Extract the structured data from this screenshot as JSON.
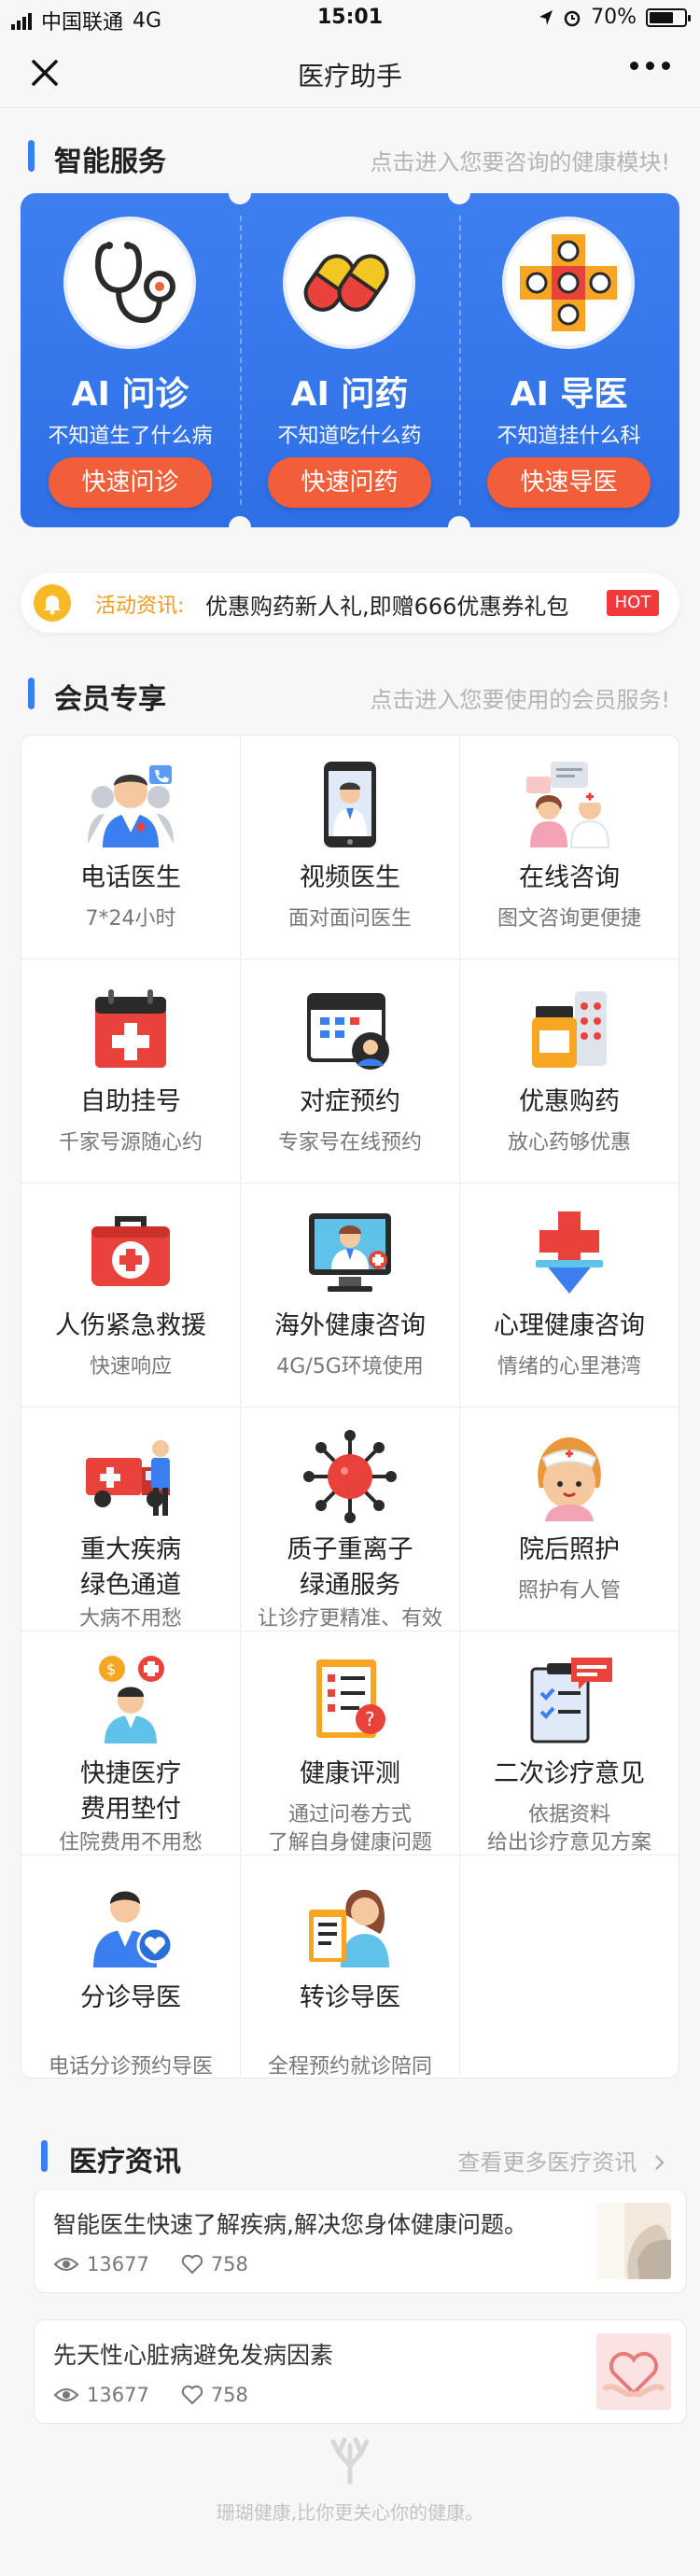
{
  "status_bar": {
    "carrier": "中国联通",
    "network": "4G",
    "time": "15:01",
    "battery": "70%",
    "battery_level": 0.7
  },
  "nav": {
    "title": "医疗助手"
  },
  "smart_service": {
    "title": "智能服务",
    "hint": "点击进入您要咨询的健康模块!",
    "cards": [
      {
        "name": "AI 问诊",
        "sub": "不知道生了什么病",
        "button": "快速问诊"
      },
      {
        "name": "AI 问药",
        "sub": "不知道吃什么药",
        "button": "快速问药"
      },
      {
        "name": "AI 导医",
        "sub": "不知道挂什么科",
        "button": "快速导医"
      }
    ]
  },
  "promo": {
    "label": "活动资讯:",
    "text": "优惠购药新人礼,即赠666优惠券礼包",
    "badge": "HOT"
  },
  "member": {
    "title": "会员专享",
    "hint": "点击进入您要使用的会员服务!",
    "items": [
      {
        "lines": [
          "电话医生"
        ],
        "subs": [
          "7*24小时"
        ]
      },
      {
        "lines": [
          "视频医生"
        ],
        "subs": [
          "面对面问医生"
        ]
      },
      {
        "lines": [
          "在线咨询"
        ],
        "subs": [
          "图文咨询更便捷"
        ]
      },
      {
        "lines": [
          "自助挂号"
        ],
        "subs": [
          "千家号源随心约"
        ]
      },
      {
        "lines": [
          "对症预约"
        ],
        "subs": [
          "专家号在线预约"
        ]
      },
      {
        "lines": [
          "优惠购药"
        ],
        "subs": [
          "放心药够优惠"
        ]
      },
      {
        "lines": [
          "人伤紧急救援"
        ],
        "subs": [
          "快速响应"
        ]
      },
      {
        "lines": [
          "海外健康咨询"
        ],
        "subs": [
          "4G/5G环境使用"
        ]
      },
      {
        "lines": [
          "心理健康咨询"
        ],
        "subs": [
          "情绪的心里港湾"
        ]
      },
      {
        "lines": [
          "重大疾病",
          "绿色通道"
        ],
        "subs": [
          "大病不用愁"
        ]
      },
      {
        "lines": [
          "质子重离子",
          "绿通服务"
        ],
        "subs": [
          "让诊疗更精准、有效"
        ]
      },
      {
        "lines": [
          "院后照护"
        ],
        "subs": [
          "照护有人管"
        ]
      },
      {
        "lines": [
          "快捷医疗",
          "费用垫付"
        ],
        "subs": [
          "住院费用不用愁"
        ]
      },
      {
        "lines": [
          "健康评测"
        ],
        "subs": [
          "通过问卷方式",
          "了解自身健康问题"
        ]
      },
      {
        "lines": [
          "二次诊疗意见"
        ],
        "subs": [
          "依据资料",
          "给出诊疗意见方案"
        ]
      },
      {
        "lines": [
          "分诊导医"
        ],
        "subs": [
          "电话分诊预约导医"
        ]
      },
      {
        "lines": [
          "转诊导医"
        ],
        "subs": [
          "全程预约就诊陪同"
        ]
      }
    ]
  },
  "news": {
    "title": "医疗资讯",
    "more": "查看更多医疗资讯",
    "articles": [
      {
        "title": "智能医生快速了解疾病,解决您身体健康问题。",
        "views": "13677",
        "likes": "758"
      },
      {
        "title": "先天性心脏病避免发病因素",
        "views": "13677",
        "likes": "758"
      }
    ]
  },
  "footer": {
    "text": "珊瑚健康,比你更关心你的健康。"
  },
  "colors": {
    "primary": "#3b7ef0",
    "button": "#f25d3a",
    "hot": "#f23a3a",
    "promo_label": "#f29b1a"
  }
}
